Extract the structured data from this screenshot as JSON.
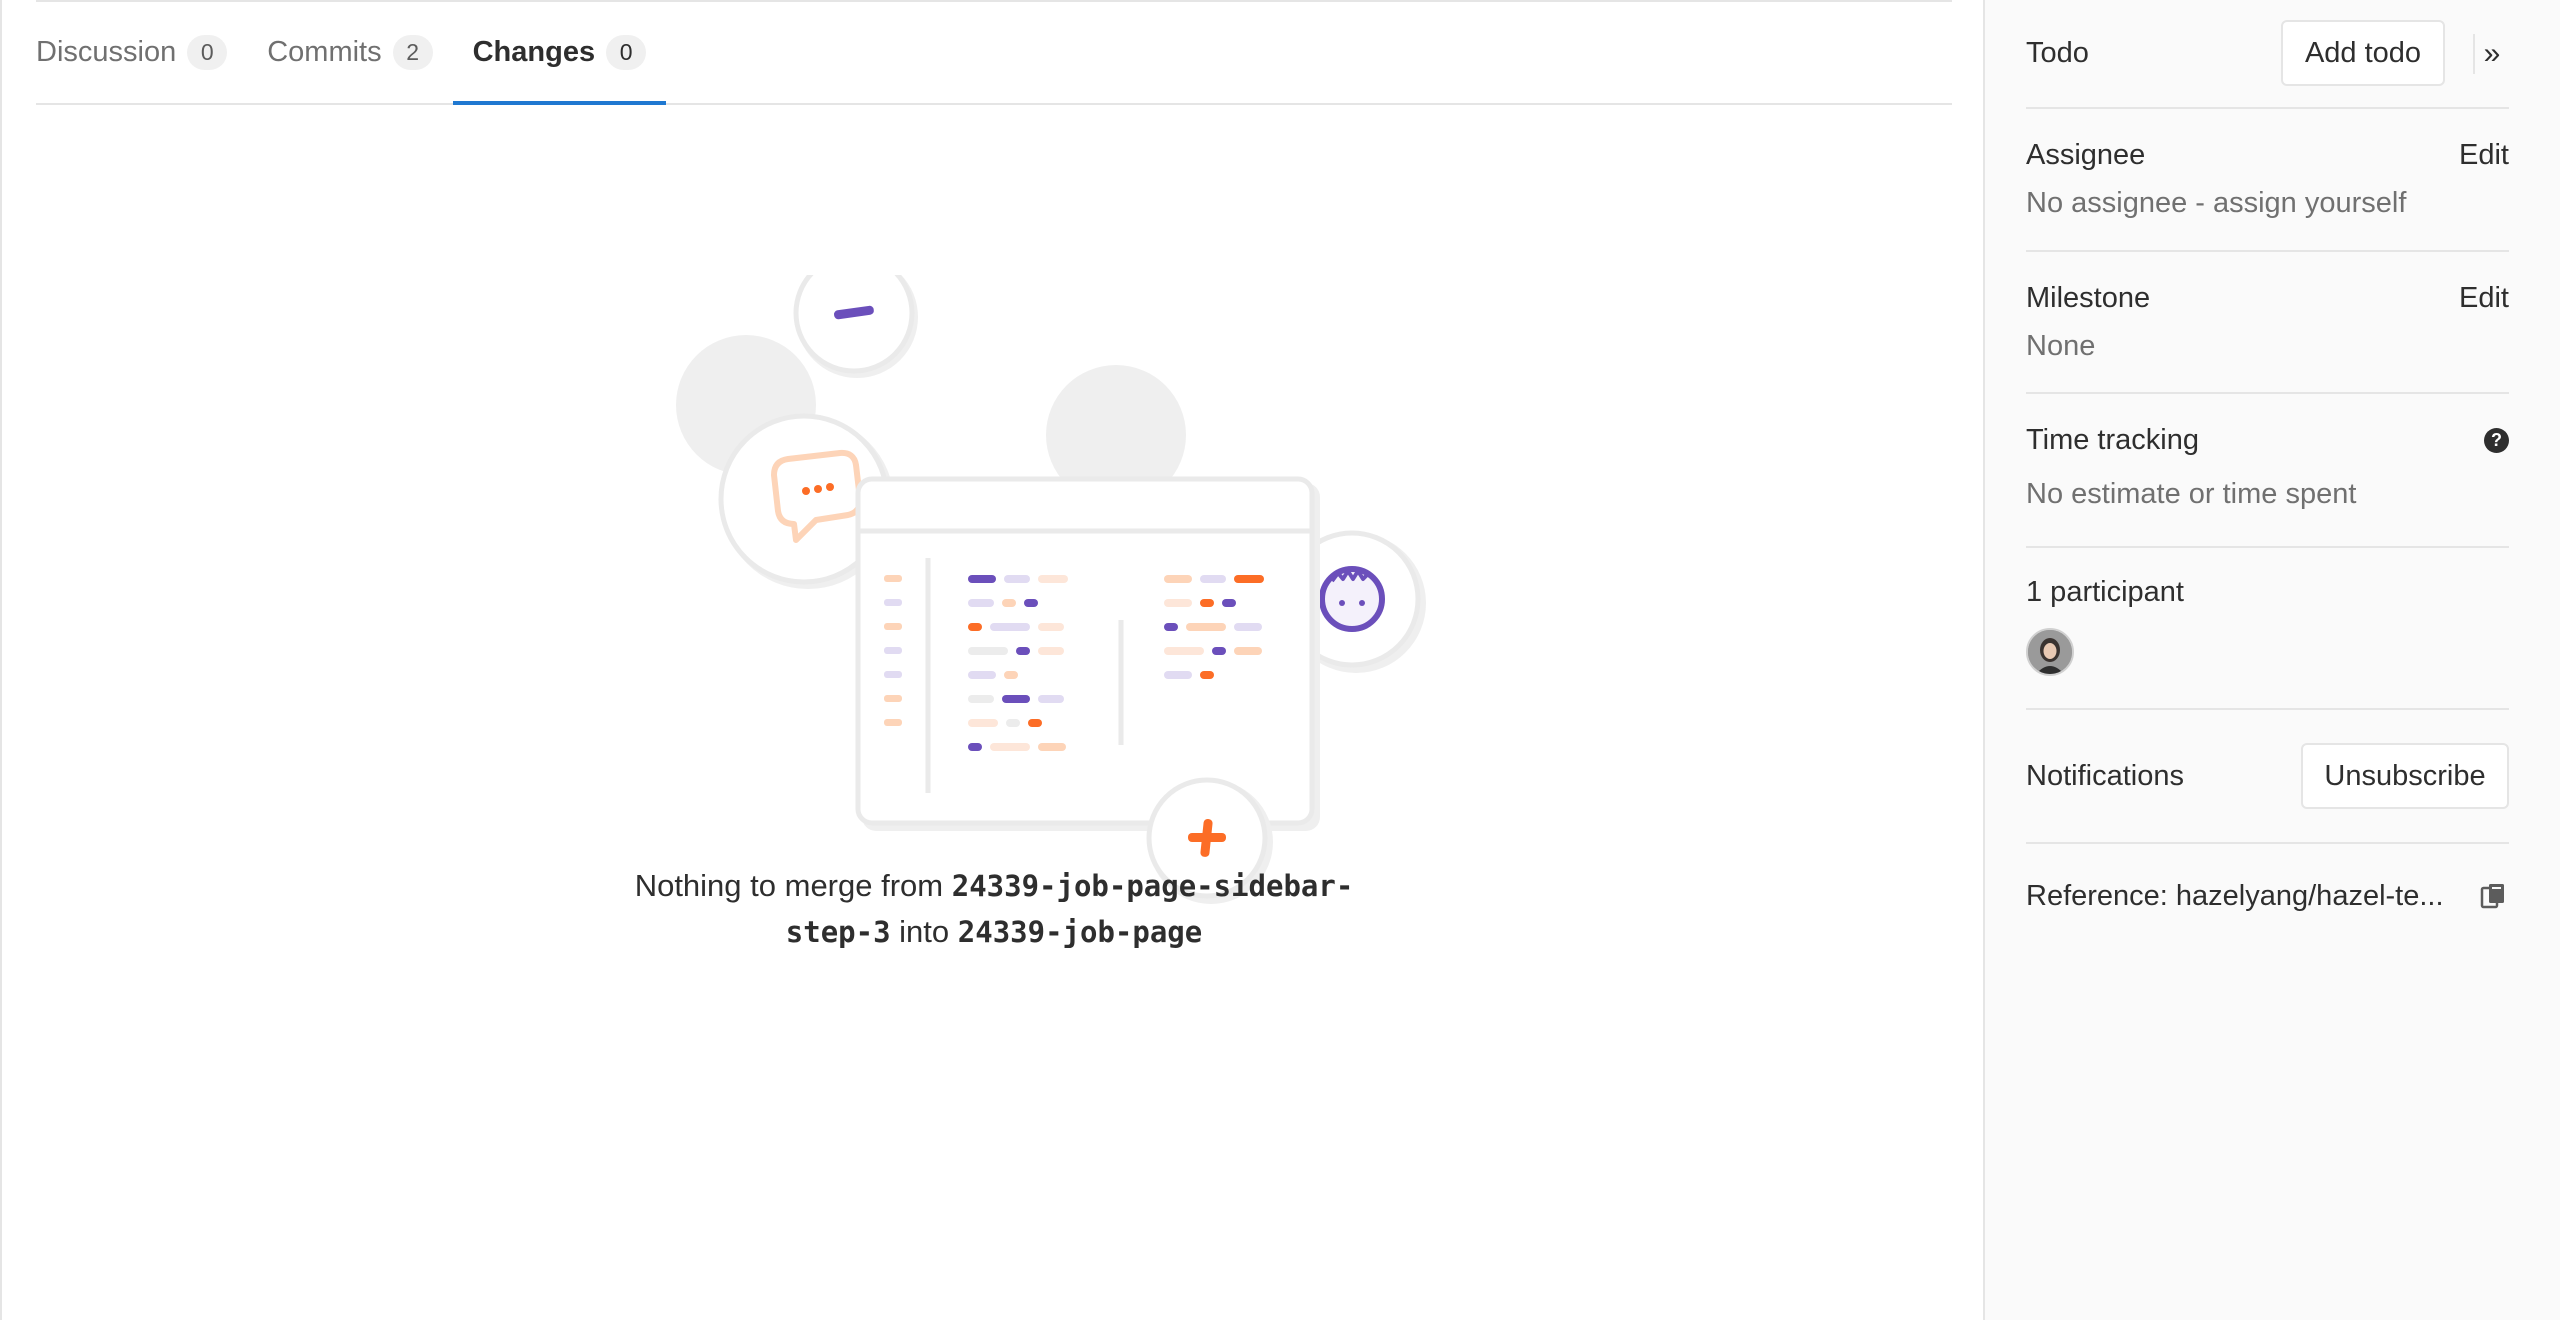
{
  "tabs": [
    {
      "label": "Discussion",
      "count": "0"
    },
    {
      "label": "Commits",
      "count": "2"
    },
    {
      "label": "Changes",
      "count": "0"
    }
  ],
  "empty_state": {
    "prefix": "Nothing to merge from",
    "source_part1": "24339-job-page-sidebar-",
    "source_part2": "step-3",
    "middle": "into",
    "target": "24339-job-page"
  },
  "sidebar": {
    "todo": {
      "title": "Todo",
      "button": "Add todo",
      "collapse_icon": "double-chevron-right-icon"
    },
    "assignee": {
      "title": "Assignee",
      "edit": "Edit",
      "value": "No assignee - assign yourself"
    },
    "milestone": {
      "title": "Milestone",
      "edit": "Edit",
      "value": "None"
    },
    "time_tracking": {
      "title": "Time tracking",
      "help": "?",
      "value": "No estimate or time spent"
    },
    "participants": {
      "title": "1 participant"
    },
    "notifications": {
      "title": "Notifications",
      "button": "Unsubscribe"
    },
    "reference": {
      "text": "Reference: hazelyang/hazel-te...",
      "icon": "copy-icon"
    }
  },
  "colors": {
    "accent_blue": "#1f78d1",
    "purple": "#6b4fbb",
    "orange": "#fc6d26",
    "light_orange": "#fdd4b8",
    "light_purple": "#e1dbf2"
  }
}
